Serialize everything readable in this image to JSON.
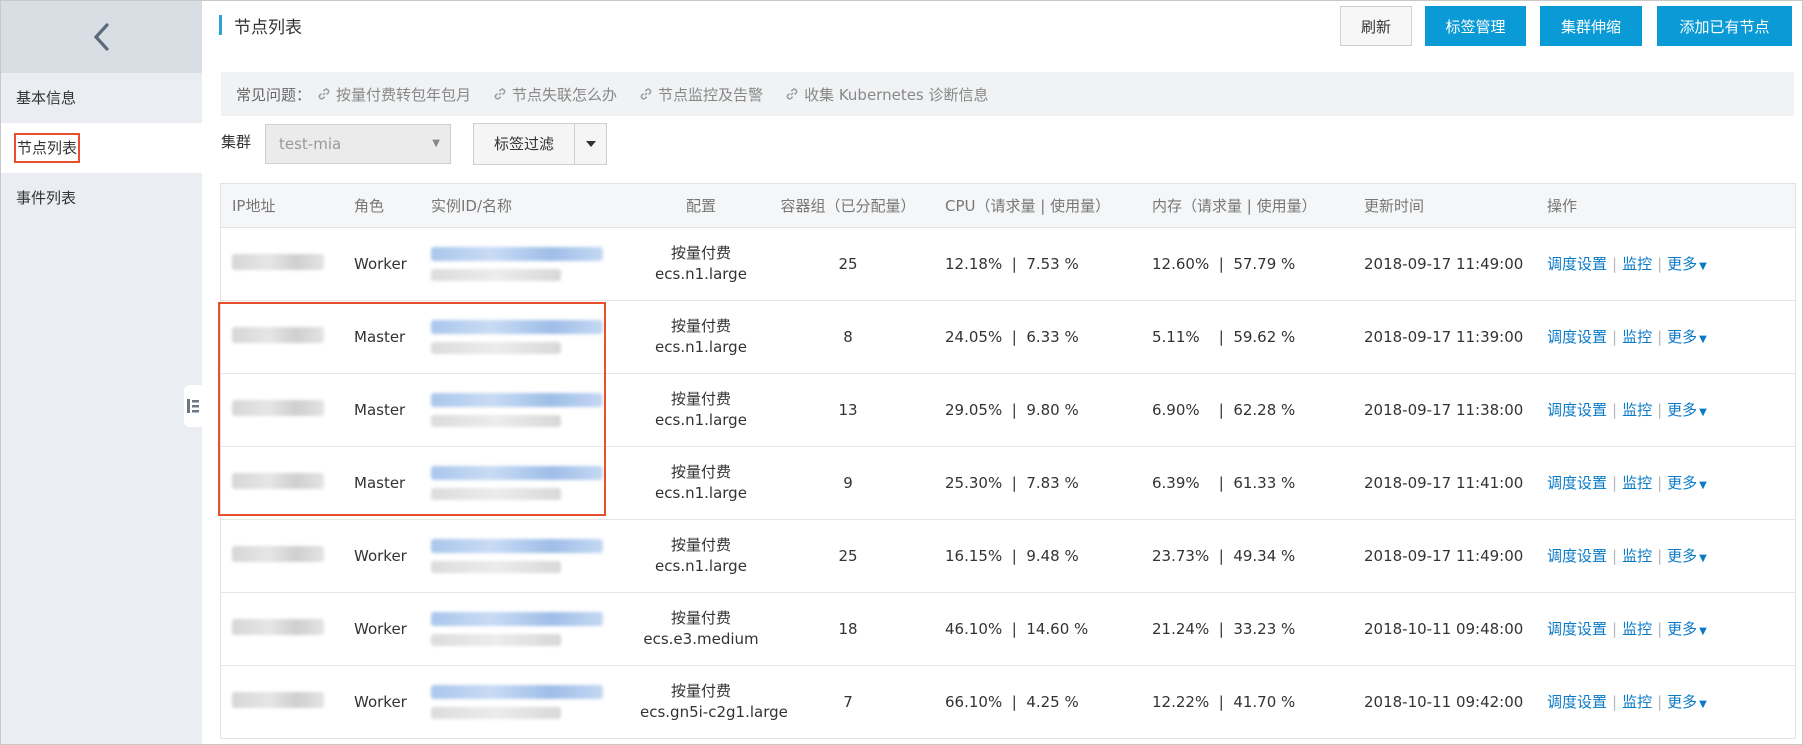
{
  "sidebar": {
    "items": [
      {
        "label": "基本信息"
      },
      {
        "label": "节点列表"
      },
      {
        "label": "事件列表"
      }
    ]
  },
  "header": {
    "title": "节点列表",
    "buttons": {
      "refresh": "刷新",
      "tag_manage": "标签管理",
      "scale": "集群伸缩",
      "add_node": "添加已有节点"
    }
  },
  "tips": {
    "label": "常见问题：",
    "links": [
      "按量付费转包年包月",
      "节点失联怎么办",
      "节点监控及告警",
      "收集 Kubernetes 诊断信息"
    ]
  },
  "filter": {
    "cluster_label": "集群",
    "cluster_value": "test-mia",
    "tag_filter": "标签过滤"
  },
  "table": {
    "columns": [
      "IP地址",
      "角色",
      "实例ID/名称",
      "配置",
      "容器组（已分配量）",
      "CPU（请求量 | 使用量）",
      "内存（请求量 | 使用量）",
      "更新时间",
      "操作"
    ],
    "ops": {
      "schedule": "调度设置",
      "monitor": "监控",
      "more": "更多"
    },
    "rows": [
      {
        "role": "Worker",
        "billing": "按量付费",
        "spec": "ecs.n1.large",
        "pods": "25",
        "cpu": "12.18%  |  7.53 %",
        "mem": "12.60%  |  57.79 %",
        "updated": "2018-09-17 11:49:00"
      },
      {
        "role": "Master",
        "billing": "按量付费",
        "spec": "ecs.n1.large",
        "pods": "8",
        "cpu": "24.05%  |  6.33 %",
        "mem": "5.11%    |  59.62 %",
        "updated": "2018-09-17 11:39:00"
      },
      {
        "role": "Master",
        "billing": "按量付费",
        "spec": "ecs.n1.large",
        "pods": "13",
        "cpu": "29.05%  |  9.80 %",
        "mem": "6.90%    |  62.28 %",
        "updated": "2018-09-17 11:38:00"
      },
      {
        "role": "Master",
        "billing": "按量付费",
        "spec": "ecs.n1.large",
        "pods": "9",
        "cpu": "25.30%  |  7.83 %",
        "mem": "6.39%    |  61.33 %",
        "updated": "2018-09-17 11:41:00"
      },
      {
        "role": "Worker",
        "billing": "按量付费",
        "spec": "ecs.n1.large",
        "pods": "25",
        "cpu": "16.15%  |  9.48 %",
        "mem": "23.73%  |  49.34 %",
        "updated": "2018-09-17 11:49:00"
      },
      {
        "role": "Worker",
        "billing": "按量付费",
        "spec": "ecs.e3.medium",
        "pods": "18",
        "cpu": "46.10%  |  14.60 %",
        "mem": "21.24%  |  33.23 %",
        "updated": "2018-10-11 09:48:00"
      },
      {
        "role": "Worker",
        "billing": "按量付费",
        "spec": "ecs.gn5i-c2g1.large",
        "pods": "7",
        "cpu": "66.10%  |  4.25 %",
        "mem": "12.22%  |  41.70 %",
        "updated": "2018-10-11 09:42:00"
      }
    ]
  },
  "colors": {
    "primary": "#0a9bd6",
    "link": "#0a7ac7",
    "highlight": "#e8502d"
  }
}
